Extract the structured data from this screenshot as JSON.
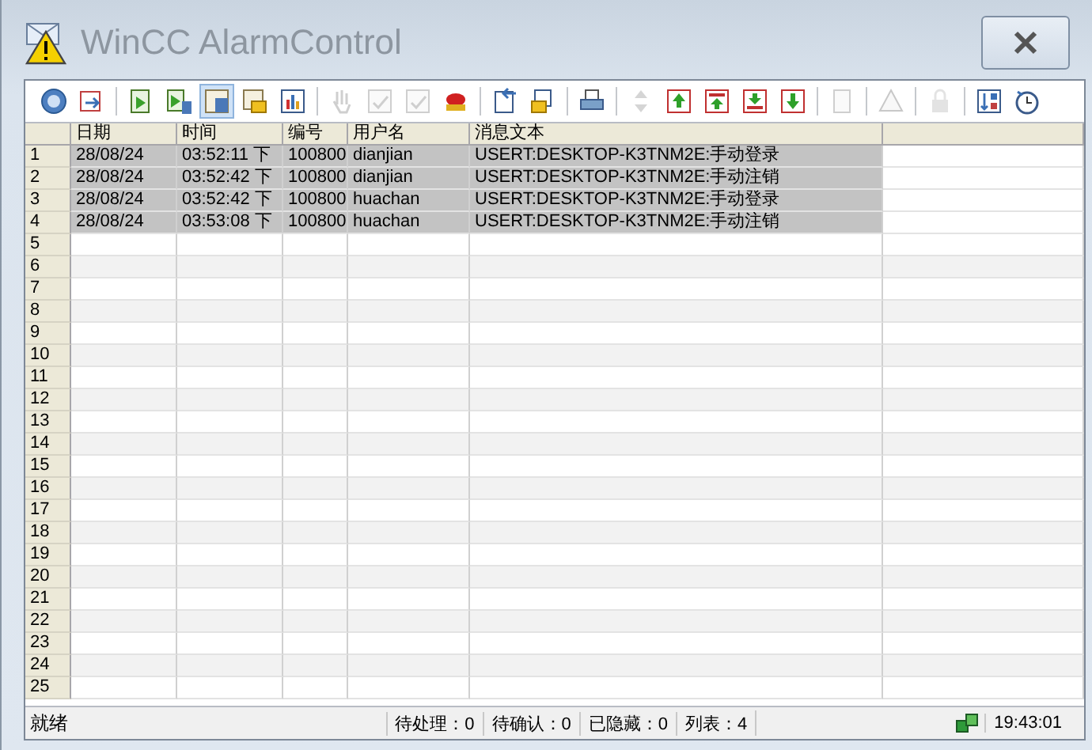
{
  "window": {
    "title": "WinCC AlarmControl"
  },
  "toolbar": {
    "groups": [
      [
        {
          "disabled": false,
          "selected": false
        },
        {
          "disabled": false,
          "selected": false
        }
      ],
      [
        {
          "disabled": false,
          "selected": false
        },
        {
          "disabled": false,
          "selected": false
        },
        {
          "disabled": false,
          "selected": true
        },
        {
          "disabled": false,
          "selected": false
        },
        {
          "disabled": false,
          "selected": false
        }
      ],
      [
        {
          "disabled": true,
          "selected": false
        },
        {
          "disabled": true,
          "selected": false
        },
        {
          "disabled": true,
          "selected": false
        },
        {
          "disabled": false,
          "selected": false
        }
      ],
      [
        {
          "disabled": false,
          "selected": false
        },
        {
          "disabled": false,
          "selected": false
        }
      ],
      [
        {
          "disabled": false,
          "selected": false
        }
      ],
      [
        {
          "disabled": true,
          "selected": false
        },
        {
          "disabled": false,
          "selected": false
        },
        {
          "disabled": false,
          "selected": false
        },
        {
          "disabled": false,
          "selected": false
        },
        {
          "disabled": false,
          "selected": false
        }
      ],
      [
        {
          "disabled": true,
          "selected": false
        }
      ],
      [
        {
          "disabled": true,
          "selected": false
        }
      ],
      [
        {
          "disabled": true,
          "selected": false
        }
      ],
      [
        {
          "disabled": false,
          "selected": false
        },
        {
          "disabled": false,
          "selected": false
        }
      ]
    ]
  },
  "table": {
    "columns": [
      "日期",
      "时间",
      "编号",
      "用户名",
      "消息文本"
    ],
    "rows": [
      {
        "number": "1",
        "cells": [
          "28/08/24",
          "03:52:11 下",
          "100800",
          "dianjian",
          "USERT:DESKTOP-K3TNM2E:手动登录"
        ]
      },
      {
        "number": "2",
        "cells": [
          "28/08/24",
          "03:52:42 下",
          "100800",
          "dianjian",
          "USERT:DESKTOP-K3TNM2E:手动注销"
        ]
      },
      {
        "number": "3",
        "cells": [
          "28/08/24",
          "03:52:42 下",
          "100800",
          "huachan",
          "USERT:DESKTOP-K3TNM2E:手动登录"
        ]
      },
      {
        "number": "4",
        "cells": [
          "28/08/24",
          "03:53:08 下",
          "100800",
          "huachan",
          "USERT:DESKTOP-K3TNM2E:手动注销"
        ]
      }
    ],
    "empty_rows": [
      "5",
      "6",
      "7",
      "8",
      "9",
      "10",
      "11",
      "12",
      "13",
      "14",
      "15",
      "16",
      "17",
      "18",
      "19",
      "20",
      "21",
      "22",
      "23",
      "24",
      "25"
    ]
  },
  "status_bar": {
    "message": "就绪",
    "counters": [
      "待处理：0",
      "待确认：0",
      "已隐藏：0",
      "列表：4"
    ],
    "time": "19:43:01"
  }
}
